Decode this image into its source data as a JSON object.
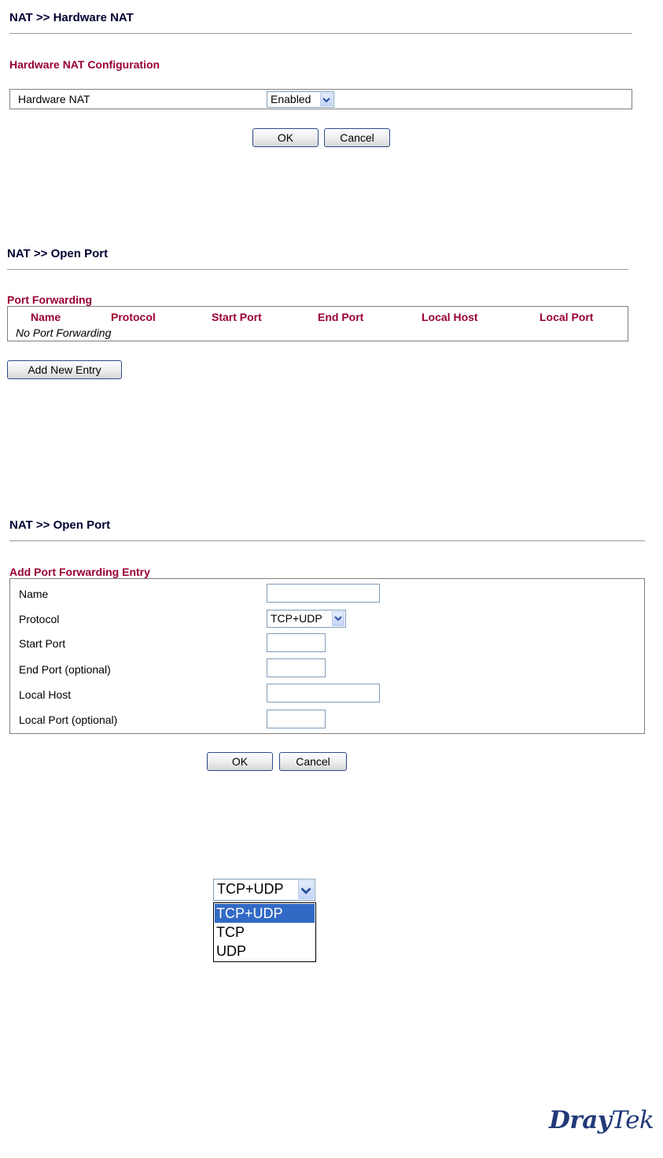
{
  "hw_nat": {
    "title": "NAT >> Hardware NAT",
    "section": "Hardware NAT Configuration",
    "row_label": "Hardware NAT",
    "select_value": "Enabled",
    "ok": "OK",
    "cancel": "Cancel"
  },
  "open_port_list": {
    "title": "NAT >> Open Port",
    "section": "Port Forwarding",
    "columns": [
      "Name",
      "Protocol",
      "Start Port",
      "End Port",
      "Local Host",
      "Local Port"
    ],
    "empty_text": "No Port Forwarding",
    "add_button": "Add New Entry"
  },
  "open_port_add": {
    "title": "NAT >> Open Port",
    "section": "Add Port Forwarding Entry",
    "fields": [
      {
        "label": "Name",
        "value": ""
      },
      {
        "label": "Protocol",
        "value": "TCP+UDP"
      },
      {
        "label": "Start Port",
        "value": ""
      },
      {
        "label": "End Port (optional)",
        "value": ""
      },
      {
        "label": "Local Host",
        "value": ""
      },
      {
        "label": "Local Port (optional)",
        "value": ""
      }
    ],
    "ok": "OK",
    "cancel": "Cancel"
  },
  "protocol_dropdown": {
    "selected": "TCP+UDP",
    "options": [
      "TCP+UDP",
      "TCP",
      "UDP"
    ],
    "highlighted_index": 0
  },
  "logo": {
    "dray": "Dray",
    "tek": "Tek"
  },
  "colors": {
    "section": "#990033",
    "highlight": "#316ac5",
    "logo": "#223a78"
  }
}
